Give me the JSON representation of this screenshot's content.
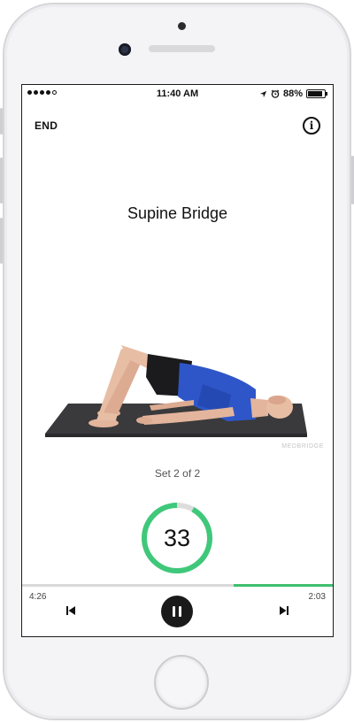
{
  "status_bar": {
    "time": "11:40 AM",
    "battery": "88%",
    "battery_level": 0.88,
    "icons": [
      "signal-dots-icon",
      "location-arrow-icon",
      "alarm-icon",
      "battery-icon"
    ]
  },
  "header": {
    "end_label": "END",
    "info_icon": "info-icon"
  },
  "exercise": {
    "title": "Supine Bridge",
    "watermark": "MEDBRIDGE",
    "set_label": "Set 2 of 2"
  },
  "timer": {
    "value": "33",
    "ring_fraction": 0.92,
    "ring_color": "#3fc87a",
    "track_color": "#dddddd"
  },
  "playback": {
    "elapsed": "4:26",
    "remaining": "2:03",
    "progress_fraction": 0.32,
    "accent_color": "#3fbf6f",
    "prev_icon": "skip-previous-icon",
    "pause_icon": "pause-icon",
    "next_icon": "skip-next-icon"
  }
}
